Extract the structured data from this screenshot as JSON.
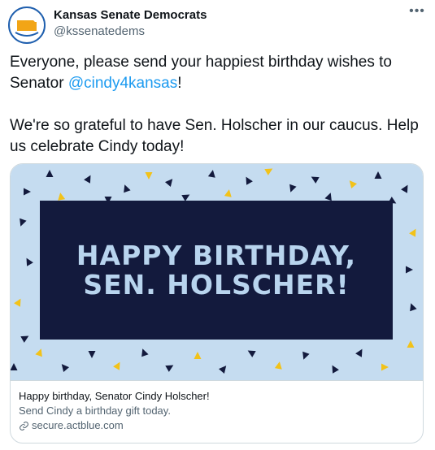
{
  "author": {
    "name": "Kansas Senate Democrats",
    "handle": "@kssenatedems",
    "avatar_text": "KANSAS SENATE DEMOCRATS"
  },
  "tweet": {
    "line1_before": "Everyone, please send your happiest birthday wishes to Senator ",
    "mention": "@cindy4kansas",
    "line1_after": "!",
    "paragraph2": "We're so grateful to have Sen. Holscher in our caucus. Help us celebrate Cindy today!"
  },
  "card": {
    "banner_line1": "HAPPY BIRTHDAY,",
    "banner_line2": "SEN. HOLSCHER!",
    "title": "Happy birthday, Senator Cindy Holscher!",
    "description": "Send Cindy a birthday gift today.",
    "domain": "secure.actblue.com"
  },
  "colors": {
    "mention": "#1d9bf0",
    "banner_bg": "#131a3d",
    "banner_text": "#b8d4ee",
    "image_bg": "#c5dcf0",
    "triangle_dark": "#131a3d",
    "triangle_yellow": "#f2c219"
  },
  "icons": {
    "more": "more-dots-icon",
    "link": "link-icon"
  }
}
